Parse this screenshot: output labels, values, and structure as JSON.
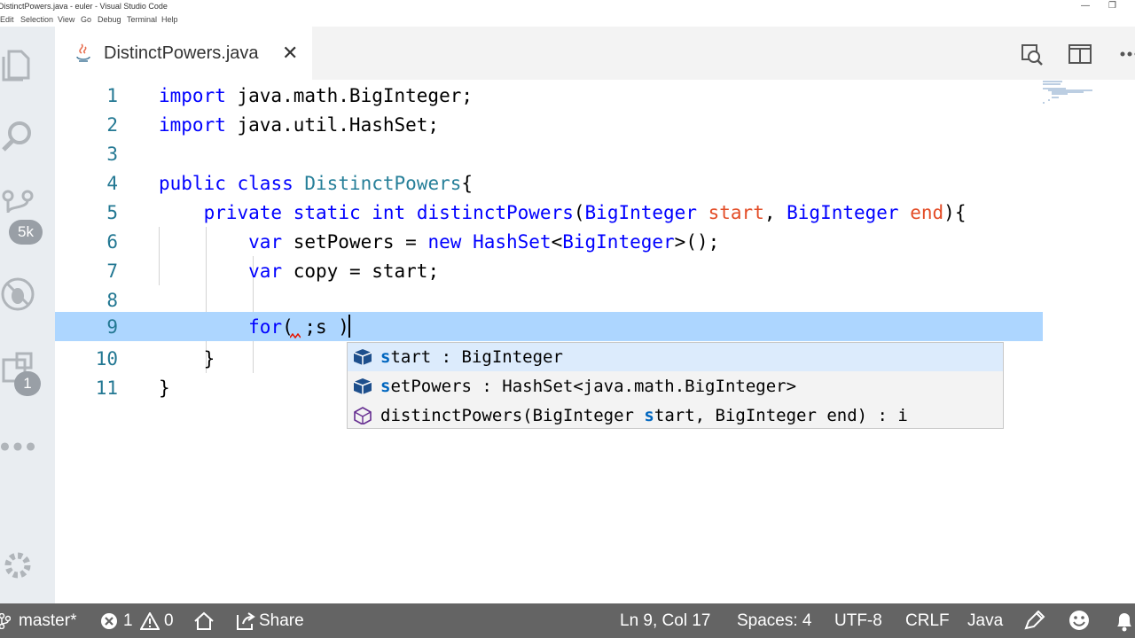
{
  "window": {
    "title": "DistinctPowers.java - euler - Visual Studio Code",
    "minimize_glyph": "—",
    "restore_glyph": "❐"
  },
  "menu": [
    "Edit",
    "Selection",
    "View",
    "Go",
    "Debug",
    "Terminal",
    "Help"
  ],
  "activity_bar": {
    "scm_badge": "5k",
    "extensions_badge": "1"
  },
  "tab": {
    "label": "DistinctPowers.java",
    "close_glyph": "✕"
  },
  "editor": {
    "line_numbers": [
      "1",
      "2",
      "3",
      "4",
      "5",
      "6",
      "7",
      "8",
      "9",
      "10",
      "11"
    ],
    "current_line": 9
  },
  "suggest": {
    "items": [
      {
        "icon": "variable-icon",
        "match": "s",
        "rest": "tart : BigInteger"
      },
      {
        "icon": "variable-icon",
        "match": "s",
        "rest": "etPowers : HashSet<java.math.BigInteger>"
      },
      {
        "icon": "method-icon",
        "pre": "distinctPowers(BigInteger ",
        "match": "s",
        "rest": "tart, BigInteger end) : i"
      }
    ]
  },
  "status": {
    "branch": "master*",
    "errors": "1",
    "warnings": "0",
    "share": "Share",
    "position": "Ln 9, Col 17",
    "spaces": "Spaces: 4",
    "encoding": "UTF-8",
    "eol": "CRLF",
    "language": "Java"
  },
  "colors": {
    "keyword": "#0000ff",
    "class": "#267f99",
    "line_number": "#237893",
    "current_line_bg": "#add6ff",
    "statusbar_bg": "#646464"
  }
}
